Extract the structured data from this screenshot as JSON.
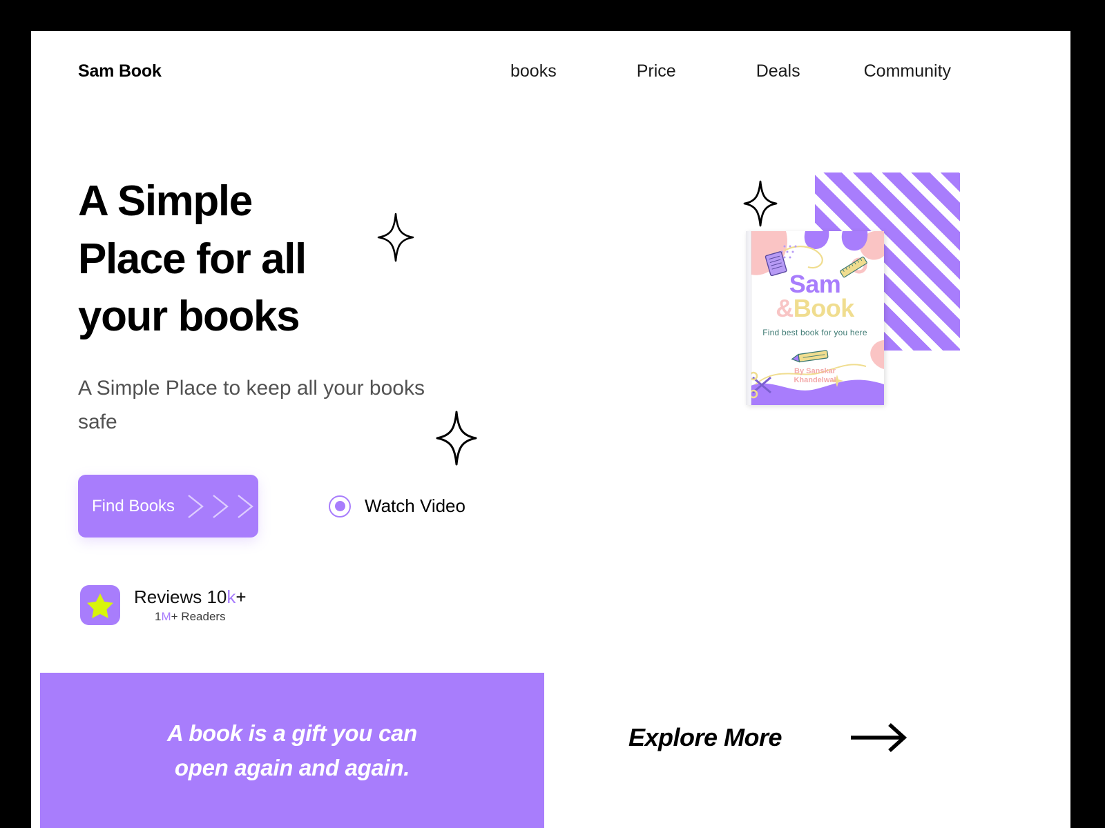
{
  "header": {
    "brand": "Sam Book",
    "nav": [
      {
        "label": "books"
      },
      {
        "label": "Price"
      },
      {
        "label": "Deals"
      },
      {
        "label": "Community"
      }
    ]
  },
  "hero": {
    "heading_line1": "A Simple",
    "heading_line2": "Place for all",
    "heading_line3": "your books",
    "subheading": "A Simple Place to keep all your books safe",
    "primary_cta": "Find Books",
    "secondary_cta": "Watch Video",
    "reviews": {
      "count_prefix": "Reviews 10",
      "count_highlight": "k",
      "count_suffix": "+",
      "readers_prefix": "1",
      "readers_highlight": "M",
      "readers_suffix": "+ Readers"
    }
  },
  "book_cover": {
    "title_top": "Sam",
    "amp": "&",
    "title_bottom": "Book",
    "tagline": "Find best book for you here",
    "author_line1": "By Sanskar",
    "author_line2": "Khandelwal"
  },
  "quote": {
    "line1": "A book is a gift you can",
    "line2": "open again and again."
  },
  "footer": {
    "explore_label": "Explore More"
  },
  "colors": {
    "accent_purple": "#a87dfc",
    "star_yellow": "#d8f50c",
    "cover_pink": "#f8c5c5",
    "cover_yellow": "#f0dd8f",
    "cover_teal": "#3e7a73",
    "page_background": "#ffffff",
    "outer_background": "#000000",
    "heading_black": "#000000",
    "body_gray": "#525252"
  }
}
